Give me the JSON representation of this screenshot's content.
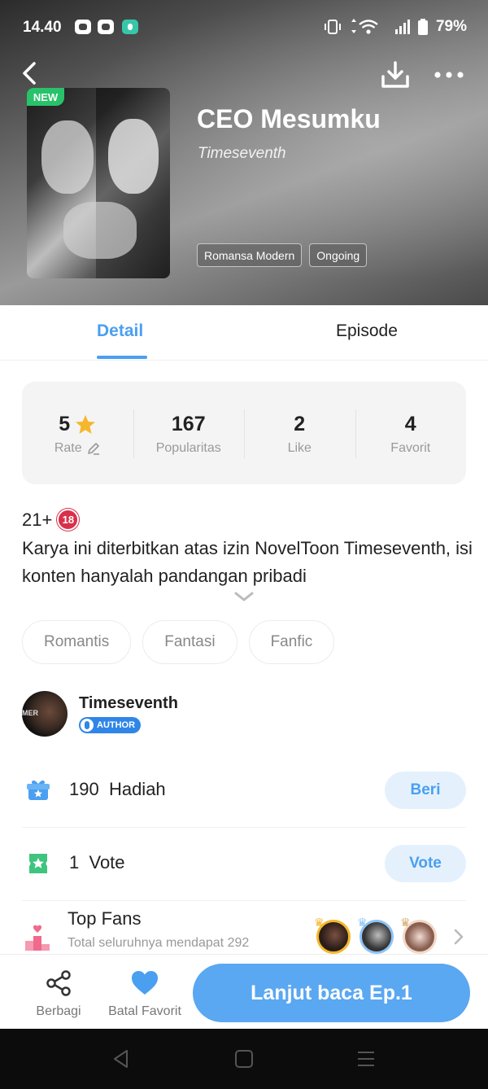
{
  "status": {
    "time": "14.40",
    "battery": "79%"
  },
  "book": {
    "new_badge": "NEW",
    "title": "CEO Mesumku",
    "author": "Timeseventh",
    "genres": [
      "Romansa Modern",
      "Ongoing"
    ]
  },
  "tabs": {
    "detail": "Detail",
    "episode": "Episode"
  },
  "stats": [
    {
      "value": "5",
      "label": "Rate"
    },
    {
      "value": "167",
      "label": "Popularitas"
    },
    {
      "value": "2",
      "label": "Like"
    },
    {
      "value": "4",
      "label": "Favorit"
    }
  ],
  "description": {
    "age": "21+",
    "age_icon": "18",
    "text": "Karya ini diterbitkan atas izin NovelToon Timeseventh, isi konten hanyalah pandangan pribadi"
  },
  "keywords": [
    "Romantis",
    "Fantasi",
    "Fanfic"
  ],
  "author": {
    "name": "Timeseventh",
    "badge": "AUTHOR"
  },
  "gift": {
    "count": "190",
    "label": "Hadiah",
    "button": "Beri"
  },
  "vote": {
    "count": "1",
    "label": "Vote",
    "button": "Vote"
  },
  "top_fans": {
    "title": "Top Fans",
    "subtitle": "Total seluruhnya mendapat 292"
  },
  "bottom": {
    "share": "Berbagi",
    "unfavorite": "Batal Favorit",
    "read": "Lanjut baca Ep.1"
  },
  "colors": {
    "accent": "#4a9ff0",
    "primary_button": "#5aa7f2",
    "new_badge": "#29c26a",
    "gift_icon": "#4a9ff0",
    "vote_icon": "#3fc47f",
    "fans_icon": "#f06a8c"
  }
}
